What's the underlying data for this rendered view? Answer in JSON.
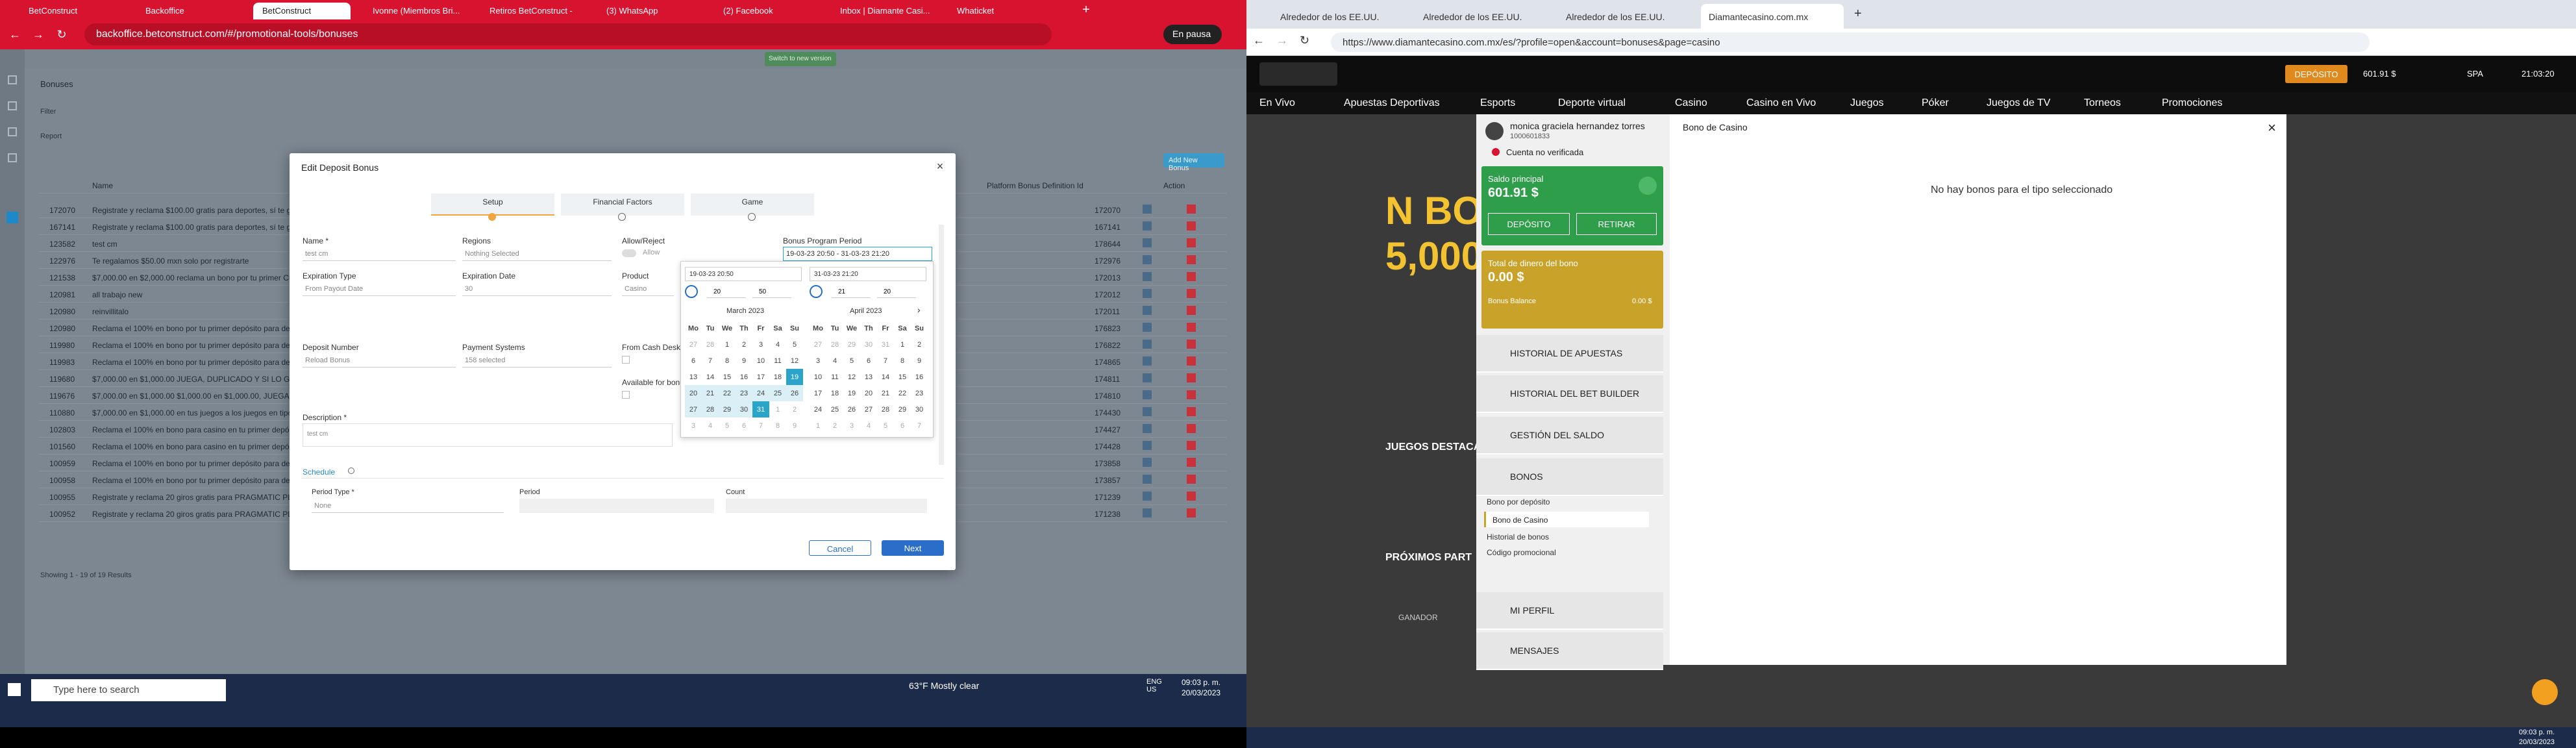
{
  "left": {
    "tabs": [
      "BetConstruct",
      "Backoffice",
      "BetConstruct",
      "Ivonne (Miembros Bri...",
      "Retiros BetConstruct -",
      "(3) WhatsApp",
      "(2) Facebook",
      "Inbox | Diamante Casi...",
      "Whaticket"
    ],
    "url": "backoffice.betconstruct.com/#/promotional-tools/bonuses",
    "pause_label": "En pausa",
    "header_btn": "Switch to new version",
    "page_title": "Bonuses",
    "filter_label": "Filter",
    "report_label": "Report",
    "add_btn": "Add New Bonus",
    "col_name": "Name",
    "col_def": "Platform Bonus Definition Id",
    "col_action": "Action",
    "rows": [
      {
        "id": "172070",
        "name": "Registrate y reclama $100.00 gratis para deportes, sí te gustan las apuestas en vivo",
        "def": "172070"
      },
      {
        "id": "167141",
        "name": "Registrate y reclama $100.00 gratis para deportes, sí te gustan las apuestas en vivo",
        "def": "167141"
      },
      {
        "id": "123582",
        "name": "test cm",
        "def": "178644"
      },
      {
        "id": "122976",
        "name": "Te regalamos $50.00 mxn solo por registrarte",
        "def": "172976"
      },
      {
        "id": "121538",
        "name": "$7,000.00 en $2,000.00 reclama un bono por tu primer CUIDADE AL",
        "def": "172013"
      },
      {
        "id": "120981",
        "name": "all trabajo new",
        "def": "172012"
      },
      {
        "id": "120980",
        "name": "reinvillitalo",
        "def": "172011"
      },
      {
        "id": "120980",
        "name": "Reclama el 100% en bono por tu primer depósito para deportes",
        "def": "176823"
      },
      {
        "id": "119980",
        "name": "Reclama el 100% en bono por tu primer depósito para deportes",
        "def": "176822"
      },
      {
        "id": "119983",
        "name": "Reclama el 100% en bono por tu primer depósito para deportes",
        "def": "174865"
      },
      {
        "id": "119680",
        "name": "$7,000.00 en $1,000.00 JUEGA, DUPLICADO Y SI LO GANAS B",
        "def": "174811"
      },
      {
        "id": "119676",
        "name": "$7,000.00 en $1,000.00 $1,000.00 en $1,000.00, JUEGA, DUP",
        "def": "174810"
      },
      {
        "id": "110880",
        "name": "$7,000.00 en $1,000.00 en tus juegos a los juegos en tipos",
        "def": "174430"
      },
      {
        "id": "102803",
        "name": "Reclama el 100% en bono para casino en tu primer depósito",
        "def": "174427"
      },
      {
        "id": "101560",
        "name": "Reclama el 100% en bono para casino en tu primer depósito",
        "def": "174428"
      },
      {
        "id": "100959",
        "name": "Reclama el 100% en bono por tu primer depósito para deportes",
        "def": "173858"
      },
      {
        "id": "100958",
        "name": "Reclama el 100% en bono por tu primer depósito para deportes",
        "def": "173857"
      },
      {
        "id": "100955",
        "name": "Registrate y reclama 20 giros gratis para PRAGMATIC PLAY",
        "def": "171239"
      },
      {
        "id": "100952",
        "name": "Registrate y reclama 20 giros gratis para PRAGMATIC PLAY",
        "def": "171238"
      }
    ],
    "footer_text": "Showing 1 - 19 of 19 Results",
    "modal": {
      "title": "Edit Deposit Bonus",
      "steps": [
        "Setup",
        "Financial Factors",
        "Game"
      ],
      "name_label": "Name *",
      "name_value": "test cm",
      "regions_label": "Regions",
      "regions_value": "Nothing Selected",
      "allow_label": "Allow/Reject",
      "allow_value": "Allow",
      "period_label": "Bonus Program Period",
      "period_value": "19-03-23 20:50 - 31-03-23 21:20",
      "exp_type_label": "Expiration Type",
      "exp_type_value": "From Payout Date",
      "exp_date_label": "Expiration Date",
      "exp_date_value": "30",
      "product_label": "Product",
      "product_value": "Casino",
      "deposit_label": "Deposit Number",
      "deposit_value": "Reload Bonus",
      "payment_label": "Payment Systems",
      "payment_value": "158 selected",
      "cash_label": "From Cash Desk",
      "avail_label": "Available for bonu",
      "desc_label": "Description *",
      "desc_value": "test cm",
      "schedule_label": "Schedule",
      "period_type_label": "Period Type *",
      "period_type_value": "None",
      "period_col": "Period",
      "count_col": "Count",
      "cancel": "Cancel",
      "next": "Next",
      "cal_start": "19-03-23 20:50",
      "cal_end": "31-03-23 21:20",
      "t1h": "20",
      "t1m": "50",
      "t2h": "21",
      "t2m": "20",
      "month1": "March 2023",
      "month2": "April 2023",
      "weekdays": [
        "Mo",
        "Tu",
        "We",
        "Th",
        "Fr",
        "Sa",
        "Su"
      ],
      "m1": [
        [
          "27",
          "28",
          "1",
          "2",
          "3",
          "4",
          "5"
        ],
        [
          "6",
          "7",
          "8",
          "9",
          "10",
          "11",
          "12"
        ],
        [
          "13",
          "14",
          "15",
          "16",
          "17",
          "18",
          "19"
        ],
        [
          "20",
          "21",
          "22",
          "23",
          "24",
          "25",
          "26"
        ],
        [
          "27",
          "28",
          "29",
          "30",
          "31",
          "1",
          "2"
        ],
        [
          "3",
          "4",
          "5",
          "6",
          "7",
          "8",
          "9"
        ]
      ],
      "m2": [
        [
          "27",
          "28",
          "29",
          "30",
          "31",
          "1",
          "2"
        ],
        [
          "3",
          "4",
          "5",
          "6",
          "7",
          "8",
          "9"
        ],
        [
          "10",
          "11",
          "12",
          "13",
          "14",
          "15",
          "16"
        ],
        [
          "17",
          "18",
          "19",
          "20",
          "21",
          "22",
          "23"
        ],
        [
          "24",
          "25",
          "26",
          "27",
          "28",
          "29",
          "30"
        ],
        [
          "1",
          "2",
          "3",
          "4",
          "5",
          "6",
          "7"
        ]
      ]
    },
    "taskbar": {
      "search": "Type here to search",
      "weather": "63°F  Mostly clear",
      "lang": "ENG\nUS",
      "time": "09:03 p. m.",
      "date": "20/03/2023"
    }
  },
  "right": {
    "tabs": [
      "Alrededor de los EE.UU.",
      "Alrededor de los EE.UU.",
      "Alrededor de los EE.UU.",
      "Diamantecasino.com.mx"
    ],
    "url": "https://www.diamantecasino.com.mx/es/?profile=open&account=bonuses&page=casino",
    "deposit_btn": "DEPÓSITO",
    "balance_top": "601.91 $",
    "lang": "SPA",
    "clock": "21:03:20",
    "nav": [
      "En Vivo",
      "Apuestas Deportivas",
      "Esports",
      "Deporte virtual",
      "Casino",
      "Casino en Vivo",
      "Juegos",
      "Póker",
      "Juegos de TV",
      "Torneos",
      "Promociones"
    ],
    "user_name": "monica graciela hernandez torres",
    "user_id": "1000601833",
    "verify": "Cuenta no verificada",
    "saldo_label": "Saldo principal",
    "saldo_value": "601.91 $",
    "deposito": "DEPÓSITO",
    "retirar": "RETIRAR",
    "total_label": "Total de dinero del bono",
    "total_value": "0.00 $",
    "bonus_balance_label": "Bonus Balance",
    "bonus_balance_value": "0.00 $",
    "menu": [
      "HISTORIAL DE APUESTAS",
      "HISTORIAL DEL BET BUILDER",
      "GESTIÓN DEL SALDO",
      "BONOS"
    ],
    "bonos_sub": [
      "Bono por depósito",
      "Bono de Casino",
      "Historial de bonos",
      "Código promocional"
    ],
    "menu2": [
      "MI PERFIL",
      "MENSAJES"
    ],
    "panel_title": "Bono de Casino",
    "empty_msg": "No hay bonos para el tipo seleccionado",
    "bg_text1": "N BONO",
    "bg_text2": "5,000",
    "juegos": "JUEGOS DESTACA",
    "proximos": "PRÓXIMOS PART",
    "ganador": "GANADOR",
    "time": "09:03 p. m.",
    "date": "20/03/2023"
  }
}
